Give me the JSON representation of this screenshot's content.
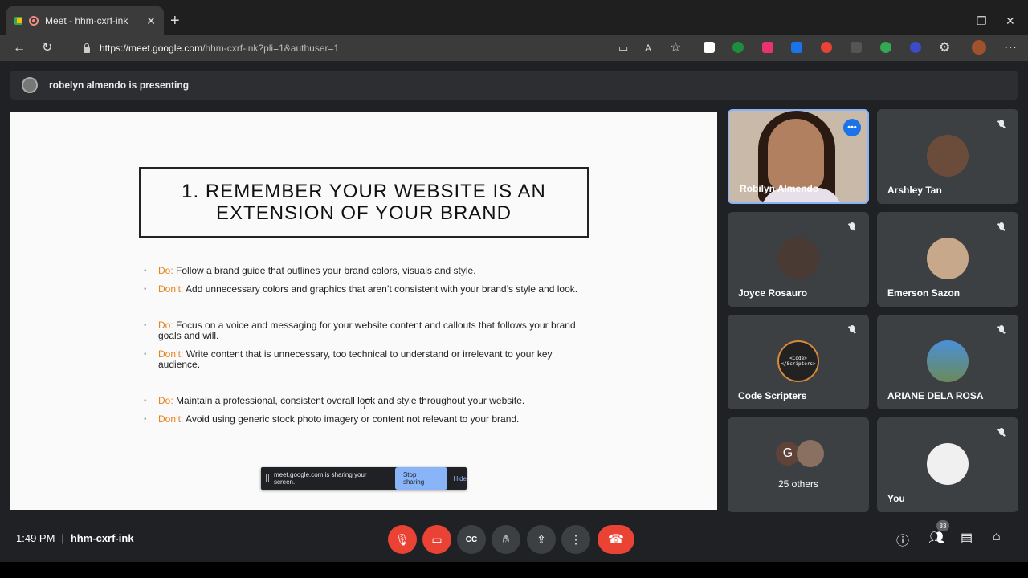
{
  "browser": {
    "tab_title": "Meet - hhm-cxrf-ink",
    "url_host": "https://meet.google.com",
    "url_path": "/hhm-cxrf-ink?pli=1&authuser=1"
  },
  "presenting_banner": "robelyn almendo is presenting",
  "slide": {
    "title": "1. REMEMBER YOUR WEBSITE IS AN EXTENSION OF YOUR BRAND",
    "groups": [
      [
        {
          "key": "Do:",
          "text": " Follow a brand guide that outlines your brand colors, visuals and style."
        },
        {
          "key": "Don’t:",
          "text": "  Add unnecessary colors and graphics that aren’t consistent with your brand’s style and look."
        }
      ],
      [
        {
          "key": "Do:",
          "text": " Focus on a voice and messaging for your website content and callouts that follows your brand goals and will."
        },
        {
          "key": "Don’t:",
          "text": "  Write content that is unnecessary, too technical to understand or irrelevant to your key audience."
        }
      ],
      [
        {
          "key": "Do:",
          "text": " Maintain a professional, consistent overall look and style throughout your website."
        },
        {
          "key": "Don’t:",
          "text": "  Avoid using generic stock photo imagery or content not relevant to your brand."
        }
      ]
    ]
  },
  "share_popup": {
    "message": "meet.google.com is sharing your screen.",
    "stop_label": "Stop sharing",
    "hide_label": "Hide"
  },
  "participants": [
    {
      "name": "Robilyn Almendo"
    },
    {
      "name": "Arshley Tan"
    },
    {
      "name": "Joyce Rosauro"
    },
    {
      "name": "Emerson Sazon"
    },
    {
      "name": "Code Scripters",
      "avatar_text": "<Code>\n</Scripters>"
    },
    {
      "name": "ARIANE DELA ROSA"
    },
    {
      "name": "You"
    }
  ],
  "others": {
    "initial": "G",
    "label": "25 others"
  },
  "bottom": {
    "time": "1:49 PM",
    "meeting_code": "hhm-cxrf-ink",
    "people_count": "33"
  },
  "colors": {
    "accent": "#8ab4f8",
    "danger": "#ea4335",
    "do_color": "#e8821a"
  }
}
